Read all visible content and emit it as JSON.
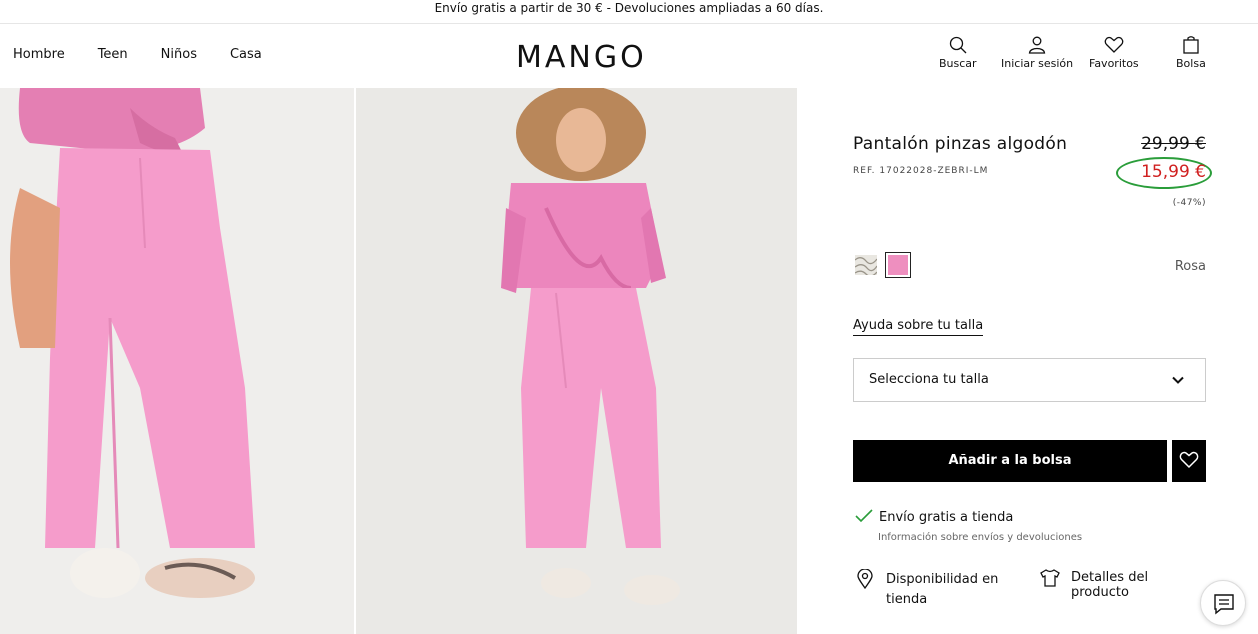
{
  "announcement": "Envío gratis a partir de 30 € - Devoluciones ampliadas a 60 días.",
  "nav": {
    "items": [
      "Hombre",
      "Teen",
      "Niños",
      "Casa"
    ]
  },
  "logo": "MANGO",
  "tools": {
    "search": "Buscar",
    "login": "Iniciar sesión",
    "favorites": "Favoritos",
    "bag": "Bolsa"
  },
  "product": {
    "title": "Pantalón pinzas algodón",
    "ref": "REF. 17022028-ZEBRI-LM",
    "old_price": "29,99 €",
    "new_price": "15,99 €",
    "discount": "(-47%)",
    "color_name": "Rosa",
    "size_help": "Ayuda sobre tu talla",
    "size_select": "Selecciona tu talla",
    "add_to_bag": "Añadir a la bolsa",
    "shipping": "Envío gratis a tienda",
    "shipping_info": "Información sobre envíos y devoluciones",
    "availability": "Disponibilidad en tienda",
    "details": "Detalles del producto"
  },
  "colors": {
    "accent": "#d02020",
    "highlight_circle": "#2a9d3a",
    "swatch_pink": "#ee8fbf",
    "button": "#000000"
  }
}
